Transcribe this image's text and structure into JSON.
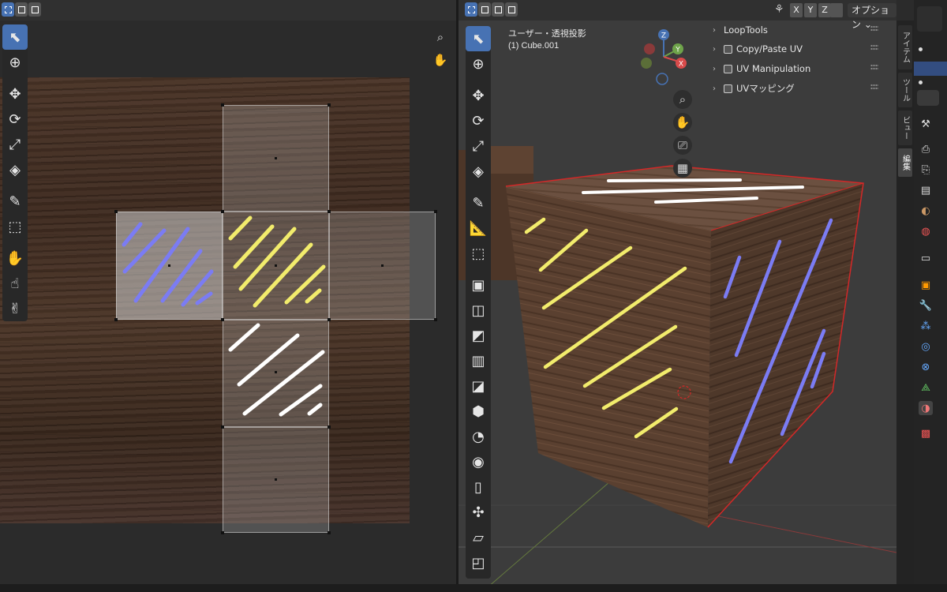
{
  "uv_editor": {
    "header": {
      "select_modes": [
        "vertex-select",
        "edge-select",
        "face-select"
      ]
    },
    "tools": [
      "select-box",
      "cursor",
      "move",
      "rotate",
      "scale",
      "transform",
      "annotate",
      "rip",
      "grab",
      "relax",
      "pinch"
    ],
    "nav": [
      "zoom-icon",
      "hand-pan-icon"
    ]
  },
  "viewport": {
    "header": {
      "select_modes": [
        "vertex-select",
        "edge-select",
        "face-select",
        "xray-toggle"
      ],
      "mirror_axes": [
        "X",
        "Y",
        "Z"
      ],
      "options_label": "オプション"
    },
    "info_line1": "ユーザー・透視投影",
    "info_line2": "(1) Cube.001",
    "gizmo": {
      "z": "Z",
      "y": "Y",
      "x": "X"
    },
    "n_panel": {
      "items": [
        {
          "label": "LoopTools",
          "has_icon": false
        },
        {
          "label": "Copy/Paste UV",
          "has_icon": true
        },
        {
          "label": "UV Manipulation",
          "has_icon": true
        },
        {
          "label": "UVマッピング",
          "has_icon": true
        }
      ]
    },
    "n_tabs": [
      "アイテム",
      "ツール",
      "ビュー",
      "編集"
    ],
    "active_n_tab": "編集"
  },
  "colors": {
    "accent": "#4772b3",
    "stroke_blue": "#7b7cf3",
    "stroke_yellow": "#f2ec6c",
    "stroke_white": "#ffffff",
    "edge_red": "#d22828"
  }
}
